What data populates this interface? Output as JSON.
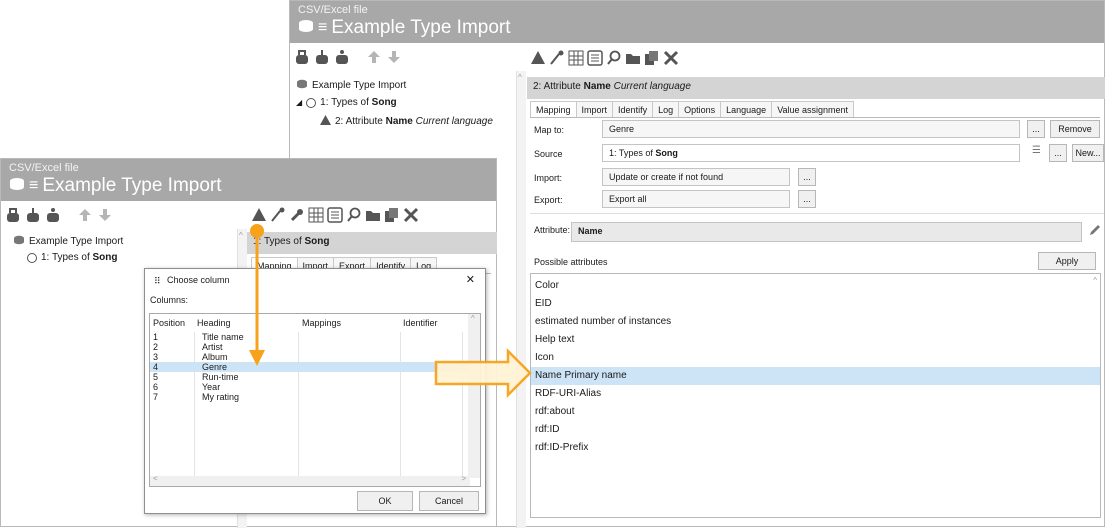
{
  "back_window": {
    "file_label": "CSV/Excel file",
    "title": "Example Type Import",
    "tree": {
      "root": "Example Type Import",
      "child_prefix": "1: Types of ",
      "child_bold": "Song",
      "grandchild_prefix": "2: Attribute ",
      "grandchild_bold": "Name",
      "grandchild_italic": "Current language"
    },
    "header": {
      "prefix": "2: Attribute ",
      "bold": "Name",
      "italic": "Current language"
    },
    "tabs": [
      "Mapping",
      "Import",
      "Identify",
      "Log",
      "Options",
      "Language",
      "Value assignment"
    ],
    "form": {
      "map_to_label": "Map to:",
      "map_to_value": "Genre",
      "map_to_browse": "...",
      "remove_button": "Remove",
      "source_label": "Source",
      "source_value_prefix": "1: Types of ",
      "source_value_bold": "Song",
      "source_browse": "...",
      "new_button": "New...",
      "import_label": "Import:",
      "import_value": "Update or create if not found",
      "import_browse": "...",
      "export_label": "Export:",
      "export_value": "Export all",
      "export_browse": "..."
    },
    "attribute_label": "Attribute:",
    "attribute_value": "Name",
    "possible_attributes_label": "Possible attributes",
    "apply_button": "Apply",
    "attributes": [
      "Color",
      "EID",
      "estimated number of instances",
      "Help text",
      "Icon",
      "Name Primary name",
      "RDF-URI-Alias",
      "rdf:about",
      "rdf:ID",
      "rdf:ID-Prefix"
    ],
    "selected_attribute_index": 5
  },
  "front_window": {
    "file_label": "CSV/Excel file",
    "title": "Example Type Import",
    "tree": {
      "root": "Example Type Import",
      "child_prefix": "1: Types of ",
      "child_bold": "Song"
    },
    "header": {
      "prefix": "1: Types of ",
      "bold": "Song"
    },
    "tabs": [
      "Mapping",
      "Import",
      "Export",
      "Identify",
      "Log"
    ]
  },
  "dialog": {
    "title": "Choose column",
    "close": "✕",
    "columns_label": "Columns:",
    "headers": [
      "Position",
      "Heading",
      "Mappings",
      "Identifier"
    ],
    "rows": [
      {
        "position": "1",
        "heading": "Title name"
      },
      {
        "position": "2",
        "heading": "Artist"
      },
      {
        "position": "3",
        "heading": "Album"
      },
      {
        "position": "4",
        "heading": "Genre"
      },
      {
        "position": "5",
        "heading": "Run-time"
      },
      {
        "position": "6",
        "heading": "Year"
      },
      {
        "position": "7",
        "heading": "My rating"
      }
    ],
    "selected_row_index": 3,
    "ok_button": "OK",
    "cancel_button": "Cancel"
  },
  "colors": {
    "titlebar": "#a8a8a8",
    "accent_arrow": "#f7a21b",
    "selection": "#cde4f7"
  }
}
